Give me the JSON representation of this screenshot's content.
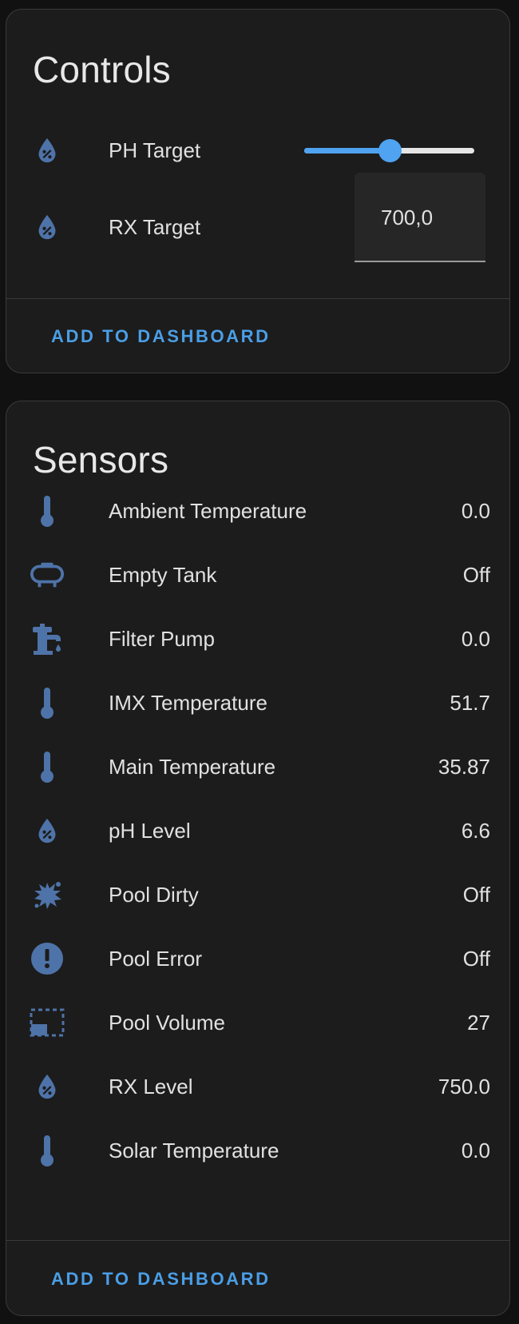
{
  "controls": {
    "title": "Controls",
    "ph_target": {
      "label": "PH Target",
      "icon": "water-percent-icon",
      "slider_fraction": 0.5
    },
    "rx_target": {
      "label": "RX Target",
      "icon": "water-percent-icon",
      "value": "700,0"
    },
    "add_button": "ADD TO DASHBOARD"
  },
  "sensors": {
    "title": "Sensors",
    "items": [
      {
        "label": "Ambient Temperature",
        "value": "0.0",
        "icon": "thermometer-icon"
      },
      {
        "label": "Empty Tank",
        "value": "Off",
        "icon": "tank-icon"
      },
      {
        "label": "Filter Pump",
        "value": "0.0",
        "icon": "water-pump-icon"
      },
      {
        "label": "IMX Temperature",
        "value": "51.7",
        "icon": "thermometer-icon"
      },
      {
        "label": "Main Temperature",
        "value": "35.87",
        "icon": "thermometer-icon"
      },
      {
        "label": "pH Level",
        "value": "6.6",
        "icon": "water-percent-icon"
      },
      {
        "label": "Pool Dirty",
        "value": "Off",
        "icon": "splat-icon"
      },
      {
        "label": "Pool Error",
        "value": "Off",
        "icon": "alert-circle-icon"
      },
      {
        "label": "Pool Volume",
        "value": "27",
        "icon": "volume-box-icon"
      },
      {
        "label": "RX Level",
        "value": "750.0",
        "icon": "water-percent-icon"
      },
      {
        "label": "Solar Temperature",
        "value": "0.0",
        "icon": "thermometer-icon"
      }
    ],
    "add_button": "ADD TO DASHBOARD"
  },
  "colors": {
    "icon": "#4e73a8",
    "accent": "#4a9ee6",
    "slider": "#4fa3f0",
    "card_bg": "#1c1c1c",
    "page_bg": "#111111"
  }
}
